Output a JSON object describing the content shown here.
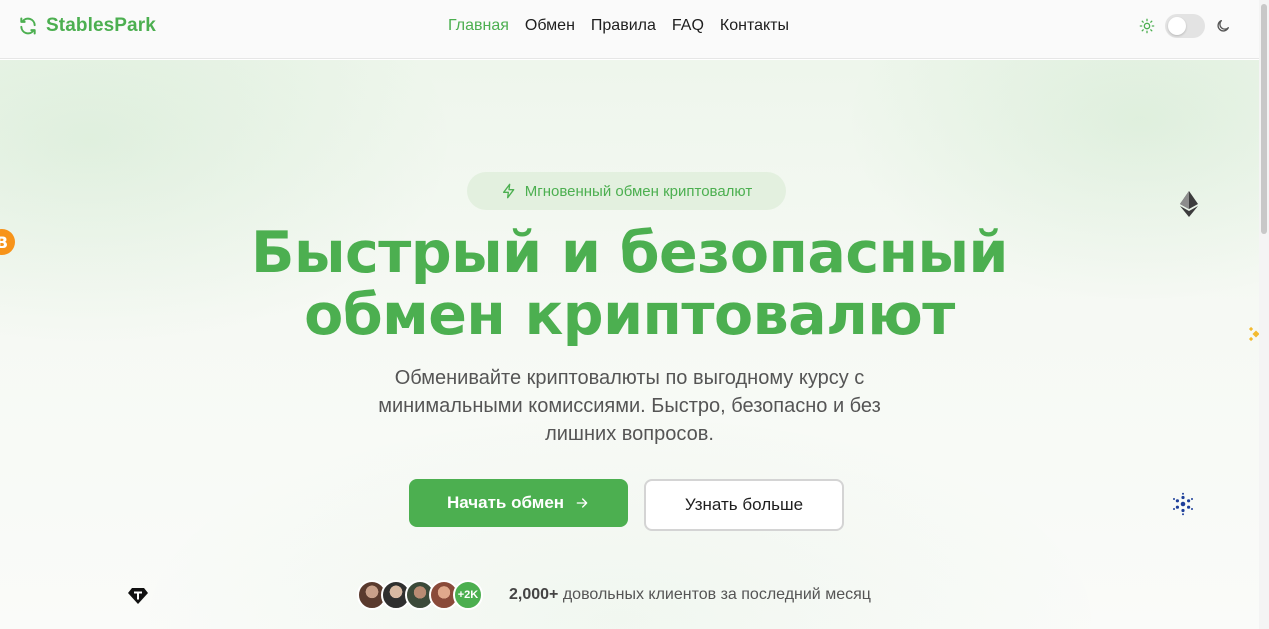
{
  "header": {
    "brand": "StablesPark",
    "nav": [
      {
        "label": "Главная",
        "active": true
      },
      {
        "label": "Обмен",
        "active": false
      },
      {
        "label": "Правила",
        "active": false
      },
      {
        "label": "FAQ",
        "active": false
      },
      {
        "label": "Контакты",
        "active": false
      }
    ],
    "theme_toggle": {
      "state": "off",
      "left_icon": "sun-icon",
      "right_icon": "moon-icon"
    }
  },
  "hero": {
    "badge": "Мгновенный обмен криптовалют",
    "badge_icon": "lightning-icon",
    "title_line1": "Быстрый и безопасный",
    "title_line2": "обмен криптовалют",
    "subtitle": "Обменивайте криптовалюты по выгодному курсу с минимальными комиссиями. Быстро, безопасно и без лишних вопросов.",
    "primary_button": "Начать обмен",
    "secondary_button": "Узнать больше",
    "clients_more": "+2K",
    "clients_count": "2,000+",
    "clients_text": " довольных клиентов за последний месяц"
  },
  "floating_coins": [
    "bitcoin-icon",
    "ethereum-icon",
    "binance-icon",
    "cardano-icon",
    "tether-icon"
  ],
  "colors": {
    "accent": "#4caf50",
    "badge_bg": "#e3f0df",
    "text_muted": "#555555",
    "bitcoin": "#f7931a",
    "binance": "#f3ba2f",
    "cardano": "#1e3f9a"
  }
}
